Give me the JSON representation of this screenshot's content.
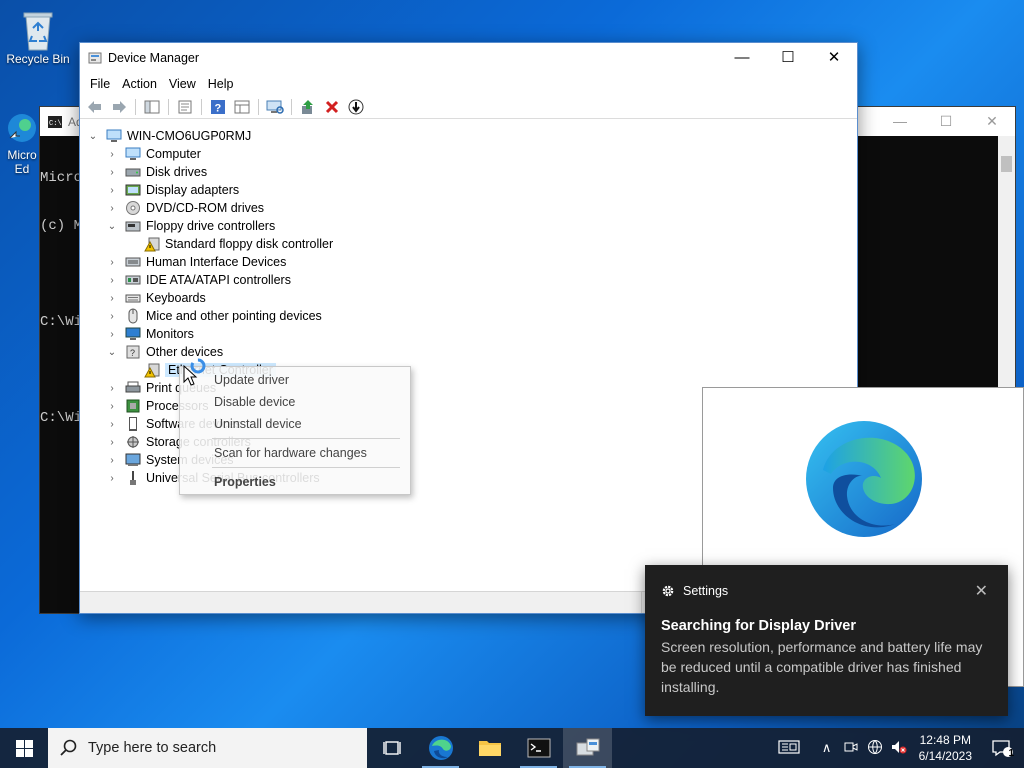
{
  "desktop": {
    "icons": [
      {
        "label": "Recycle Bin"
      },
      {
        "label": "Micro\nEd"
      }
    ]
  },
  "console": {
    "title": "Ad",
    "lines": [
      "Micro",
      "(c) M",
      "",
      "C:\\Wi",
      "",
      "C:\\Wi"
    ]
  },
  "device_manager": {
    "title": "Device Manager",
    "menu": [
      "File",
      "Action",
      "View",
      "Help"
    ],
    "root": "WIN-CMO6UGP0RMJ",
    "tree": [
      {
        "label": "Computer",
        "expanded": false,
        "icon": "computer-icon"
      },
      {
        "label": "Disk drives",
        "expanded": false,
        "icon": "disk-icon"
      },
      {
        "label": "Display adapters",
        "expanded": false,
        "icon": "display-icon"
      },
      {
        "label": "DVD/CD-ROM drives",
        "expanded": false,
        "icon": "dvd-icon"
      },
      {
        "label": "Floppy drive controllers",
        "expanded": true,
        "icon": "floppy-icon"
      },
      {
        "label": "Standard floppy disk controller",
        "child": true,
        "icon": "warning-device-icon"
      },
      {
        "label": "Human Interface Devices",
        "expanded": false,
        "icon": "hid-icon"
      },
      {
        "label": "IDE ATA/ATAPI controllers",
        "expanded": false,
        "icon": "ide-icon"
      },
      {
        "label": "Keyboards",
        "expanded": false,
        "icon": "keyboard-icon"
      },
      {
        "label": "Mice and other pointing devices",
        "expanded": false,
        "icon": "mouse-icon"
      },
      {
        "label": "Monitors",
        "expanded": false,
        "icon": "monitor-icon"
      },
      {
        "label": "Other devices",
        "expanded": true,
        "icon": "other-devices-icon"
      },
      {
        "label": "Ethernet Controller",
        "child": true,
        "icon": "warning-device-icon",
        "selected": true
      },
      {
        "label": "Print queues",
        "expanded": false,
        "icon": "printer-icon"
      },
      {
        "label": "Processors",
        "expanded": false,
        "icon": "cpu-icon"
      },
      {
        "label": "Software devices",
        "expanded": false,
        "icon": "software-icon"
      },
      {
        "label": "Storage controllers",
        "expanded": false,
        "icon": "storage-icon"
      },
      {
        "label": "System devices",
        "expanded": false,
        "icon": "system-icon"
      },
      {
        "label": "Universal Serial Bus controllers",
        "expanded": false,
        "icon": "usb-icon"
      }
    ]
  },
  "context_menu": {
    "items": [
      "Update driver",
      "Disable device",
      "Uninstall device",
      "Scan for hardware changes",
      "Properties"
    ]
  },
  "toast": {
    "app": "Settings",
    "title": "Searching for Display Driver",
    "body": "Screen resolution, performance and battery life may be reduced until a compatible driver has finished installing."
  },
  "taskbar": {
    "search_placeholder": "Type here to search",
    "time": "12:48 PM",
    "date": "6/14/2023",
    "notification_count": "1"
  },
  "colors": {
    "accent": "#0078d4",
    "toast_bg": "#1f1f1f",
    "taskbar_bg": "#142034"
  }
}
